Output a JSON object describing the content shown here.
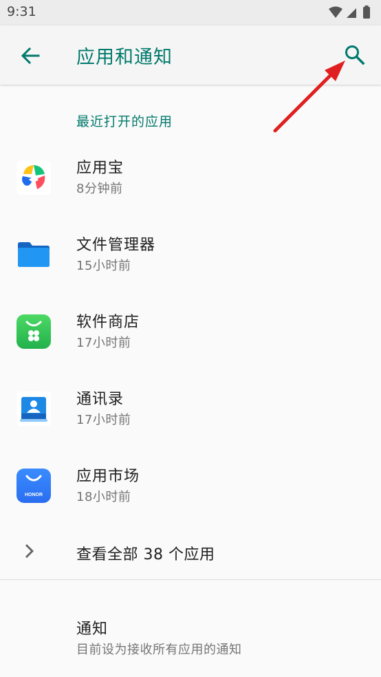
{
  "status_bar": {
    "time": "9:31",
    "icons": [
      "wifi-icon",
      "signal-icon",
      "battery-icon"
    ]
  },
  "app_bar": {
    "title": "应用和通知",
    "back_icon": "arrow-left-icon",
    "search_icon": "search-icon"
  },
  "recent": {
    "header": "最近打开的应用",
    "items": [
      {
        "name": "应用宝",
        "time": "8分钟前",
        "icon": "yingyongbao-icon"
      },
      {
        "name": "文件管理器",
        "time": "15小时前",
        "icon": "folder-icon"
      },
      {
        "name": "软件商店",
        "time": "17小时前",
        "icon": "software-store-icon"
      },
      {
        "name": "通讯录",
        "time": "17小时前",
        "icon": "contacts-icon"
      },
      {
        "name": "应用市场",
        "time": "18小时前",
        "icon": "app-market-icon"
      }
    ],
    "see_all": "查看全部 38 个应用"
  },
  "notifications": {
    "title": "通知",
    "summary": "目前设为接收所有应用的通知"
  },
  "colors": {
    "accent": "#00796b",
    "primary_text": "#212121",
    "secondary_text": "#757575",
    "annotation_arrow": "#e02020"
  },
  "app_icon_labels": {
    "app_market_brand": "HONOR"
  }
}
